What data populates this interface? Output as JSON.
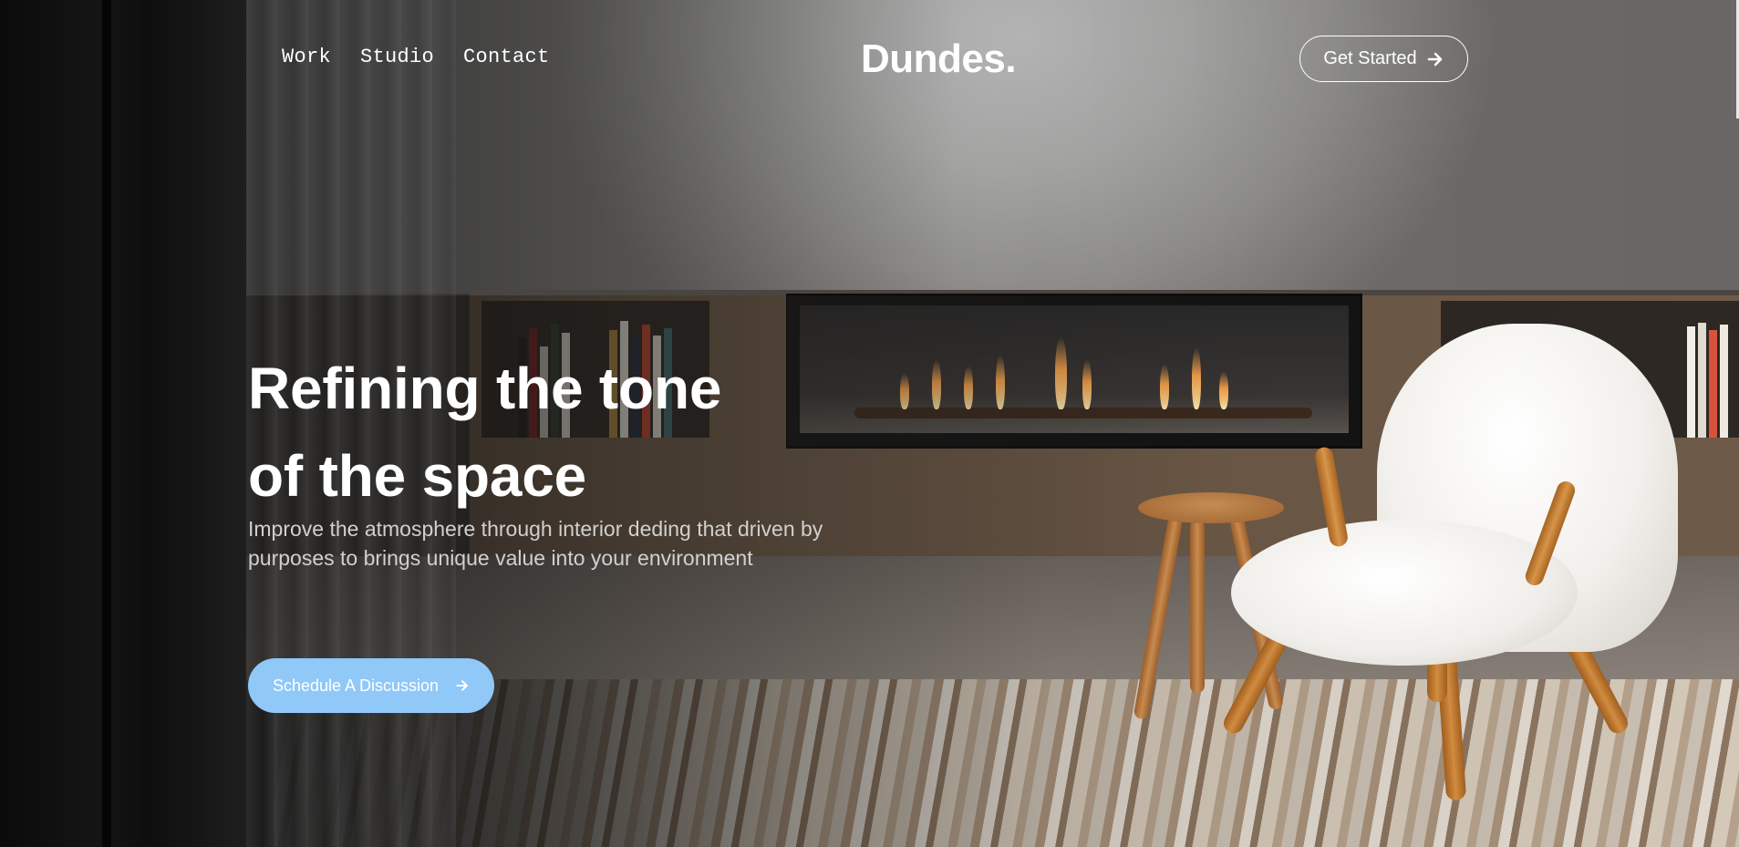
{
  "nav": {
    "links": [
      "Work",
      "Studio",
      "Contact"
    ],
    "logo": "Dundes.",
    "cta_label": "Get Started",
    "cta_icon": "arrow-right-icon"
  },
  "hero": {
    "headline_line1": "Refining the tone",
    "headline_line2": "of the space",
    "subtext_line1": "Improve the atmosphere through interior deding that driven by",
    "subtext_line2": "purposes to brings unique value into your environment",
    "button_label": "Schedule A Discussion",
    "button_icon": "arrow-right-icon"
  },
  "colors": {
    "cta_button": "#90c8f8",
    "text": "#ffffff",
    "subtext": "#d2d0cd"
  },
  "background": {
    "description_icon": "interior-scene-image"
  }
}
